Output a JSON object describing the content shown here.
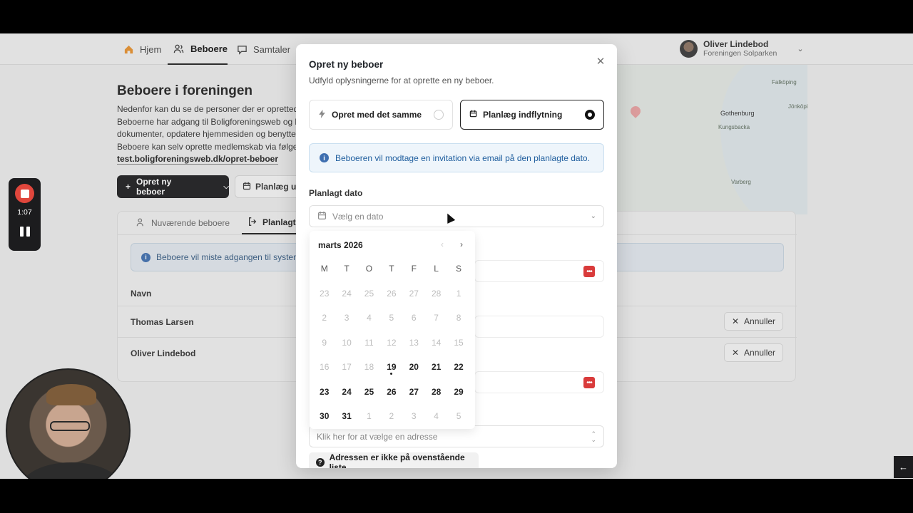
{
  "nav": {
    "items": [
      {
        "label": "Hjem",
        "icon": "home-icon"
      },
      {
        "label": "Beboere",
        "icon": "users-icon",
        "active": true
      },
      {
        "label": "Samtaler",
        "icon": "chat-icon"
      }
    ]
  },
  "user": {
    "name": "Oliver Lindebod",
    "org": "Foreningen Solparken"
  },
  "map": {
    "labels": [
      "Gothenburg",
      "Falköping",
      "Kungsbacka",
      "Varberg",
      "Jönköpi"
    ]
  },
  "page": {
    "title": "Beboere i foreningen",
    "desc_lines": [
      "Nedenfor kan du se de personer der er oprettede",
      "Beboerne har adgang til Boligforeningsweb og ka",
      "dokumenter, opdatere hjemmesiden og benytte b",
      "Beboere kan selv oprette medlemskab via følgen"
    ],
    "link": "test.boligforeningsweb.dk/opret-beboer",
    "link_suffix": ".",
    "primary_button": "Opret ny beboer",
    "secondary_button": "Planlæg ud"
  },
  "card": {
    "tabs": [
      "Nuværende beboere",
      "Planlagte"
    ],
    "alert": "Beboere vil miste adgangen til system",
    "column_header": "Navn",
    "rows": [
      {
        "name": "Thomas Larsen",
        "action": "Annuller"
      },
      {
        "name": "Oliver Lindebod",
        "action": "Annuller"
      }
    ]
  },
  "recorder": {
    "time": "1:07"
  },
  "modal": {
    "title": "Opret ny beboer",
    "subtitle": "Udfyld oplysningerne for at oprette en ny beboer.",
    "option_now": "Opret med det samme",
    "option_plan": "Planlæg indflytning",
    "info": "Beboeren vil modtage en invitation via email på den planlagte dato.",
    "date_label": "Planlagt dato",
    "date_placeholder": "Vælg en dato",
    "address_placeholder": "Klik her for at vælge en adresse",
    "address_missing_button": "Adressen er ikke på ovenstående liste"
  },
  "calendar": {
    "month": "marts 2026",
    "weekdays": [
      "M",
      "T",
      "O",
      "T",
      "F",
      "L",
      "S"
    ],
    "weeks": [
      [
        {
          "d": "23",
          "s": "out"
        },
        {
          "d": "24",
          "s": "out"
        },
        {
          "d": "25",
          "s": "out"
        },
        {
          "d": "26",
          "s": "out"
        },
        {
          "d": "27",
          "s": "out"
        },
        {
          "d": "28",
          "s": "out"
        },
        {
          "d": "1",
          "s": "dis"
        }
      ],
      [
        {
          "d": "2",
          "s": "dis"
        },
        {
          "d": "3",
          "s": "dis"
        },
        {
          "d": "4",
          "s": "dis"
        },
        {
          "d": "5",
          "s": "dis"
        },
        {
          "d": "6",
          "s": "dis"
        },
        {
          "d": "7",
          "s": "dis"
        },
        {
          "d": "8",
          "s": "dis"
        }
      ],
      [
        {
          "d": "9",
          "s": "dis"
        },
        {
          "d": "10",
          "s": "dis"
        },
        {
          "d": "11",
          "s": "dis"
        },
        {
          "d": "12",
          "s": "dis"
        },
        {
          "d": "13",
          "s": "dis"
        },
        {
          "d": "14",
          "s": "dis"
        },
        {
          "d": "15",
          "s": "dis"
        }
      ],
      [
        {
          "d": "16",
          "s": "dis"
        },
        {
          "d": "17",
          "s": "dis"
        },
        {
          "d": "18",
          "s": "dis"
        },
        {
          "d": "19",
          "s": "today"
        },
        {
          "d": "20",
          "s": "avail"
        },
        {
          "d": "21",
          "s": "avail"
        },
        {
          "d": "22",
          "s": "avail"
        }
      ],
      [
        {
          "d": "23",
          "s": "avail"
        },
        {
          "d": "24",
          "s": "avail"
        },
        {
          "d": "25",
          "s": "avail"
        },
        {
          "d": "26",
          "s": "avail"
        },
        {
          "d": "27",
          "s": "avail"
        },
        {
          "d": "28",
          "s": "avail"
        },
        {
          "d": "29",
          "s": "avail"
        }
      ],
      [
        {
          "d": "30",
          "s": "avail"
        },
        {
          "d": "31",
          "s": "avail"
        },
        {
          "d": "1",
          "s": "out"
        },
        {
          "d": "2",
          "s": "out"
        },
        {
          "d": "3",
          "s": "out"
        },
        {
          "d": "4",
          "s": "out"
        },
        {
          "d": "5",
          "s": "out"
        }
      ]
    ]
  },
  "colors": {
    "accent": "#1f5e9e",
    "primary": "#1d1d1f",
    "danger": "#d93b3b",
    "record": "#e0463c"
  }
}
